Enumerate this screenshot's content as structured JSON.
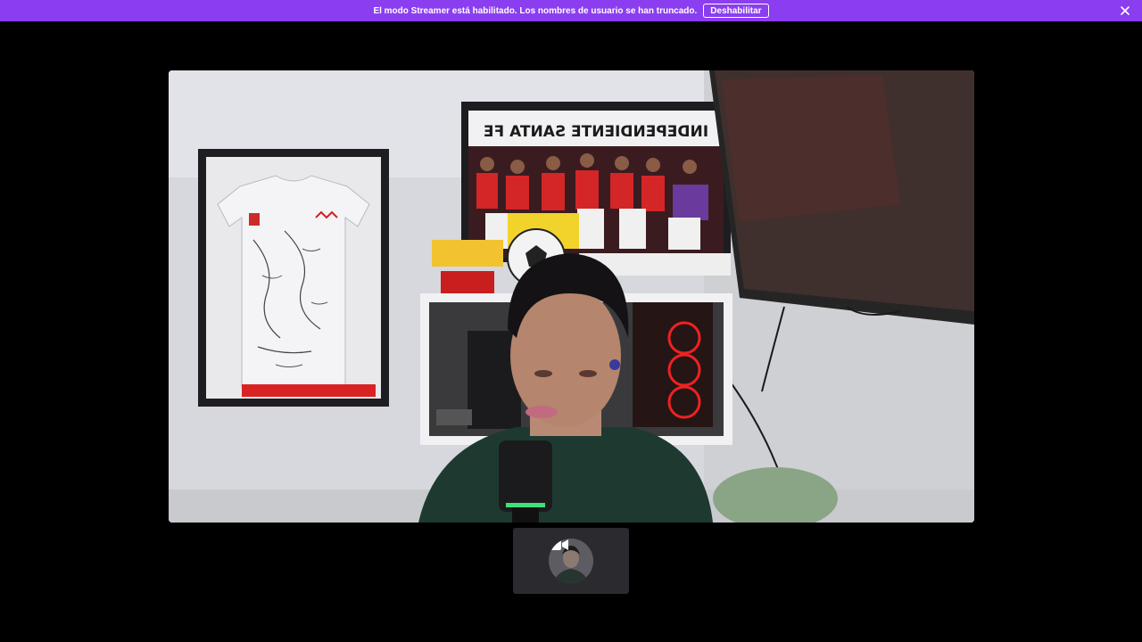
{
  "banner": {
    "message": "El modo Streamer está habilitado. Los nombres de usuario se han truncado.",
    "disable_label": "Deshabilitar",
    "close_icon": "close-icon",
    "color": "#8a3ef0"
  },
  "main_video": {
    "poster_text": "INDEPENDIENTE SANTA FE",
    "description_icon": "video-stream"
  },
  "thumbnail": {
    "icon": "camera-icon"
  }
}
